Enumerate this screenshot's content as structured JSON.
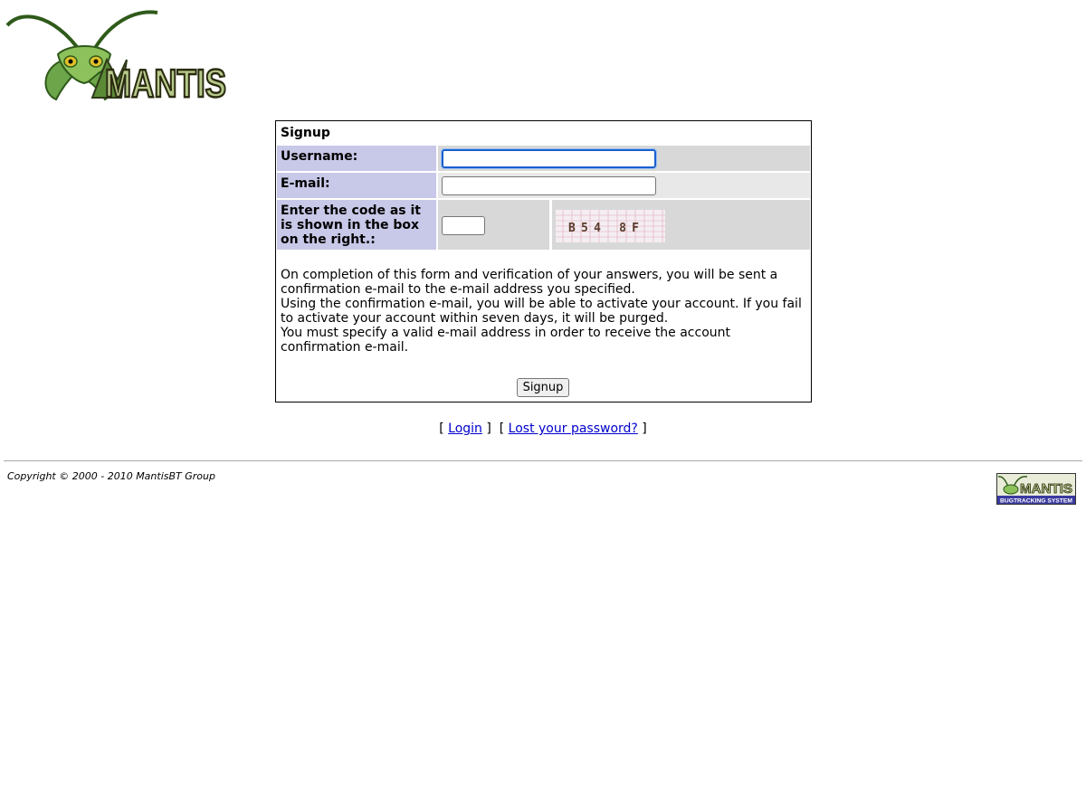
{
  "header": {
    "logo_text": "MANTIS"
  },
  "form": {
    "title": "Signup",
    "username_label": "Username:",
    "email_label": "E-mail:",
    "code_label": "Enter the code as it is shown in the box on the right.:",
    "username_value": "",
    "email_value": "",
    "code_value": "",
    "captcha_text": "B54 8F",
    "info_lines": [
      "On completion of this form and verification of your answers, you will be sent a confirmation e-mail to the e-mail address you specified.",
      "Using the confirmation e-mail, you will be able to activate your account. If you fail to activate your account within seven days, it will be purged.",
      "You must specify a valid e-mail address in order to receive the account confirmation e-mail."
    ],
    "submit_label": "Signup"
  },
  "links": {
    "login": "Login",
    "lost_password": "Lost your password?"
  },
  "footer": {
    "copyright": "Copyright © 2000 - 2010 MantisBT Group",
    "badge_top": "MANTIS",
    "badge_bottom": "BUGTRACKING SYSTEM"
  },
  "colors": {
    "label_bg": "#c8c8e8",
    "row_bg_dark": "#d8d8d8",
    "row_bg_light": "#e8e8e8",
    "link": "#0000cc"
  }
}
